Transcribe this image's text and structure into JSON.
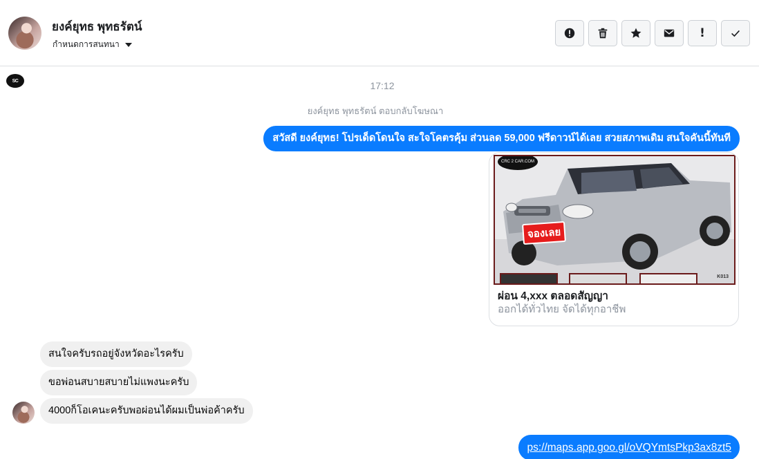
{
  "header": {
    "contact_name": "ยงค์ยุทธ พุทธรัตน์",
    "label_dropdown": "กำหนดการสนทนา"
  },
  "toolbar": {
    "buttons": [
      {
        "name": "report",
        "icon": "alert-circle-icon"
      },
      {
        "name": "delete",
        "icon": "trash-icon"
      },
      {
        "name": "star",
        "icon": "star-icon"
      },
      {
        "name": "mark-unread",
        "icon": "envelope-icon"
      },
      {
        "name": "important",
        "icon": "exclamation-icon",
        "glyph": "!"
      },
      {
        "name": "done",
        "icon": "check-icon"
      }
    ]
  },
  "conversation": {
    "timestamp": "17:12",
    "system_message": "ยงค์ยุทธ พุทธรัตน์ ตอบกลับโฆษณา",
    "outgoing_1": "สวัสดี ยงค์ยุทธ! โปรเด็ดโดนใจ สะใจโคตรคุ้ม ส่วนลด 59,000 ฟรีดาวน์ได้เลย สวยสภาพเดิม สนใจคันนี้ทันที",
    "ad_card": {
      "title": "ผ่อน 4,xxx ตลอดสัญญา",
      "subtitle": "ออกได้ทั่วไทย จัดได้ทุกอาชีพ",
      "image_badge": "จองเลย",
      "image_logo": "CRC 2 CAR.COM",
      "image_code": "K013"
    },
    "incoming": [
      "สนใจครับรถอยู่จังหวัดอะไรครับ",
      "ขอพ่อนสบายสบายไม่แพงนะครับ",
      "4000ก็โอเคนะครับพอผ่อนได้ผมเป็นพ่อค้าครับ"
    ],
    "outgoing_2_link": "ps://maps.app.goo.gl/oVQYmtsPkp3ax8zt5"
  },
  "colors": {
    "outgoing_bubble": "#0a7cff",
    "incoming_bubble": "#f0f0f0",
    "muted_text": "#8d949e"
  }
}
